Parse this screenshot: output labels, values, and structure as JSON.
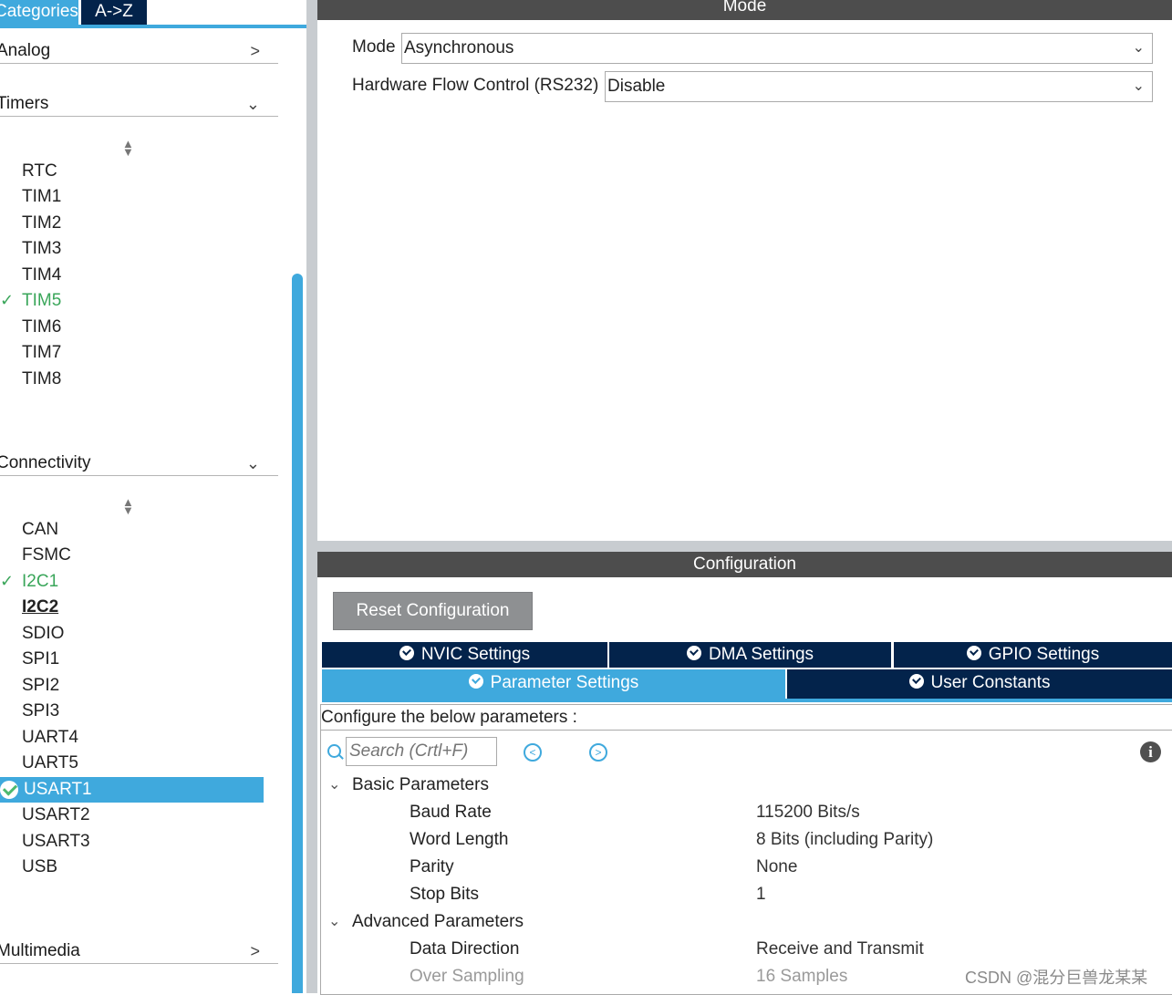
{
  "left_tabs": {
    "categories": "Categories",
    "az": "A->Z"
  },
  "categories": [
    {
      "label": "Analog",
      "expanded": false
    },
    {
      "label": "Timers",
      "expanded": true,
      "items": [
        {
          "label": "RTC",
          "state": "normal"
        },
        {
          "label": "TIM1",
          "state": "normal"
        },
        {
          "label": "TIM2",
          "state": "normal"
        },
        {
          "label": "TIM3",
          "state": "normal"
        },
        {
          "label": "TIM4",
          "state": "normal"
        },
        {
          "label": "TIM5",
          "state": "enabled"
        },
        {
          "label": "TIM6",
          "state": "normal"
        },
        {
          "label": "TIM7",
          "state": "normal"
        },
        {
          "label": "TIM8",
          "state": "normal"
        }
      ]
    },
    {
      "label": "Connectivity",
      "expanded": true,
      "items": [
        {
          "label": "CAN",
          "state": "normal"
        },
        {
          "label": "FSMC",
          "state": "normal"
        },
        {
          "label": "I2C1",
          "state": "enabled"
        },
        {
          "label": "I2C2",
          "state": "bold"
        },
        {
          "label": "SDIO",
          "state": "normal"
        },
        {
          "label": "SPI1",
          "state": "normal"
        },
        {
          "label": "SPI2",
          "state": "normal"
        },
        {
          "label": "SPI3",
          "state": "normal"
        },
        {
          "label": "UART4",
          "state": "normal"
        },
        {
          "label": "UART5",
          "state": "normal"
        },
        {
          "label": "USART1",
          "state": "selected"
        },
        {
          "label": "USART2",
          "state": "normal"
        },
        {
          "label": "USART3",
          "state": "normal"
        },
        {
          "label": "USB",
          "state": "normal"
        }
      ]
    },
    {
      "label": "Multimedia",
      "expanded": false
    }
  ],
  "mode": {
    "title": "Mode",
    "mode_label": "Mode",
    "mode_value": "Asynchronous",
    "flow_label": "Hardware Flow Control (RS232)",
    "flow_value": "Disable"
  },
  "config": {
    "title": "Configuration",
    "reset_label": "Reset Configuration",
    "tabs_row1": [
      "NVIC Settings",
      "DMA Settings",
      "GPIO Settings"
    ],
    "tabs_row2": [
      "Parameter Settings",
      "User Constants"
    ],
    "active_tab": "Parameter Settings",
    "caption": "Configure the below parameters :",
    "search_placeholder": "Search (Crtl+F)",
    "groups": [
      {
        "label": "Basic Parameters",
        "params": [
          {
            "name": "Baud Rate",
            "value": "115200 Bits/s"
          },
          {
            "name": "Word Length",
            "value": "8 Bits (including Parity)"
          },
          {
            "name": "Parity",
            "value": "None"
          },
          {
            "name": "Stop Bits",
            "value": "1"
          }
        ]
      },
      {
        "label": "Advanced Parameters",
        "params": [
          {
            "name": "Data Direction",
            "value": "Receive and Transmit"
          },
          {
            "name": "Over Sampling",
            "value": "16 Samples",
            "disabled": true
          }
        ]
      }
    ]
  },
  "watermark": "CSDN @混分巨兽龙某某",
  "colors": {
    "accent": "#3fa9dd",
    "navy": "#03234b",
    "enabled_green": "#3aa65a",
    "title_bar": "#4d4d4d"
  }
}
